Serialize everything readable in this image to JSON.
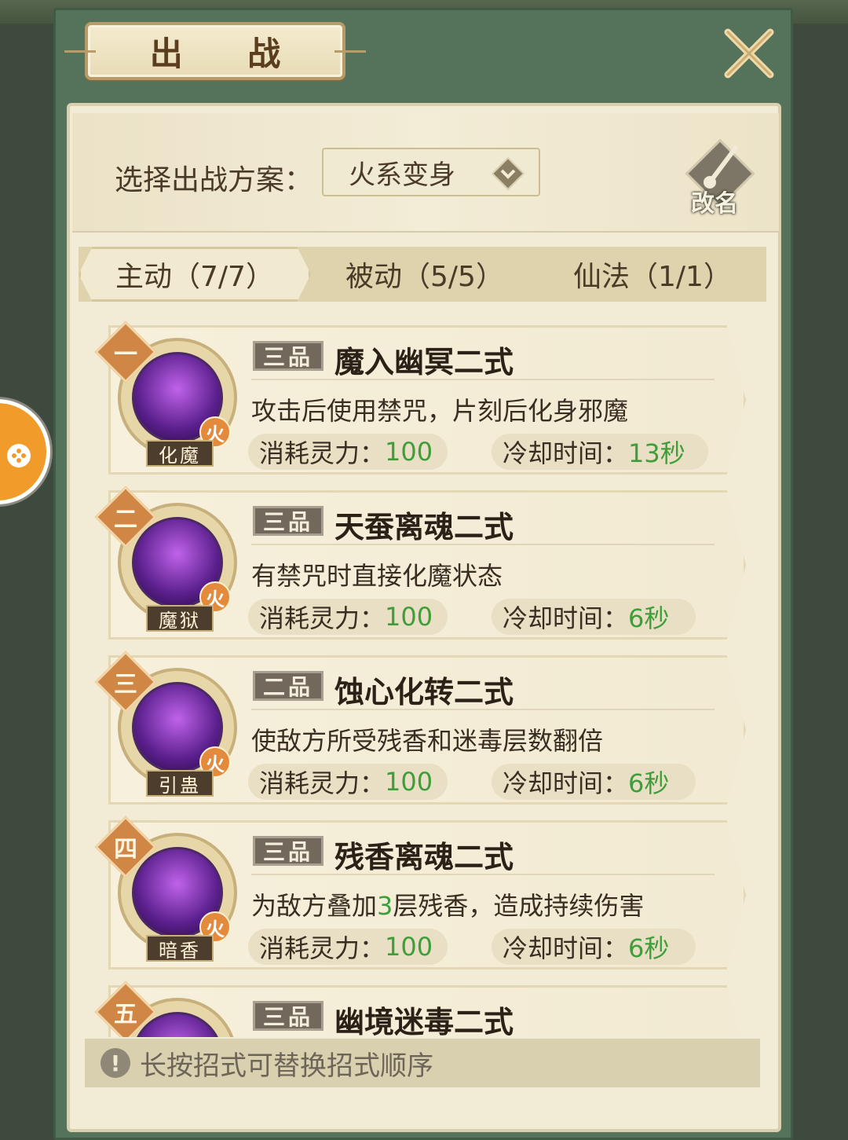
{
  "window": {
    "title": "出 战",
    "close_icon": "close-icon"
  },
  "scheme": {
    "label": "选择出战方案：",
    "selected": "火系变身",
    "rename_label": "改名"
  },
  "tabs": [
    {
      "label": "主动（7/7）",
      "active": true
    },
    {
      "label": "被动（5/5）",
      "active": false
    },
    {
      "label": "仙法（1/1）",
      "active": false
    }
  ],
  "skills": [
    {
      "rank": "一",
      "icon_name": "化魔",
      "element": "火",
      "grade": "三品",
      "name": "魔入幽冥二式",
      "desc": "攻击后使用禁咒，片刻后化身邪魔",
      "cost_label": "消耗灵力：",
      "cost": "100",
      "cd_label": "冷却时间：",
      "cd": "13秒"
    },
    {
      "rank": "二",
      "icon_name": "魔狱",
      "element": "火",
      "grade": "三品",
      "name": "天蚕离魂二式",
      "desc": "有禁咒时直接化魔状态",
      "cost_label": "消耗灵力：",
      "cost": "100",
      "cd_label": "冷却时间：",
      "cd": "6秒"
    },
    {
      "rank": "三",
      "icon_name": "引蛊",
      "element": "火",
      "grade": "二品",
      "name": "蚀心化转二式",
      "desc": "使敌方所受残香和迷毒层数翻倍",
      "cost_label": "消耗灵力：",
      "cost": "100",
      "cd_label": "冷却时间：",
      "cd": "6秒"
    },
    {
      "rank": "四",
      "icon_name": "暗香",
      "element": "火",
      "grade": "三品",
      "name": "残香离魂二式",
      "desc_pre": "为敌方叠加",
      "desc_num": "3",
      "desc_post": "层残香，造成持续伤害",
      "cost_label": "消耗灵力：",
      "cost": "100",
      "cd_label": "冷却时间：",
      "cd": "6秒"
    },
    {
      "rank": "五",
      "grade": "三品",
      "name": "幽境迷毒二式"
    }
  ],
  "hint": {
    "text": "长按招式可替换招式顺序"
  },
  "colors": {
    "accent_green": "#3f9e3a",
    "panel_green": "#55735a",
    "rank_orange": "#d08645"
  }
}
